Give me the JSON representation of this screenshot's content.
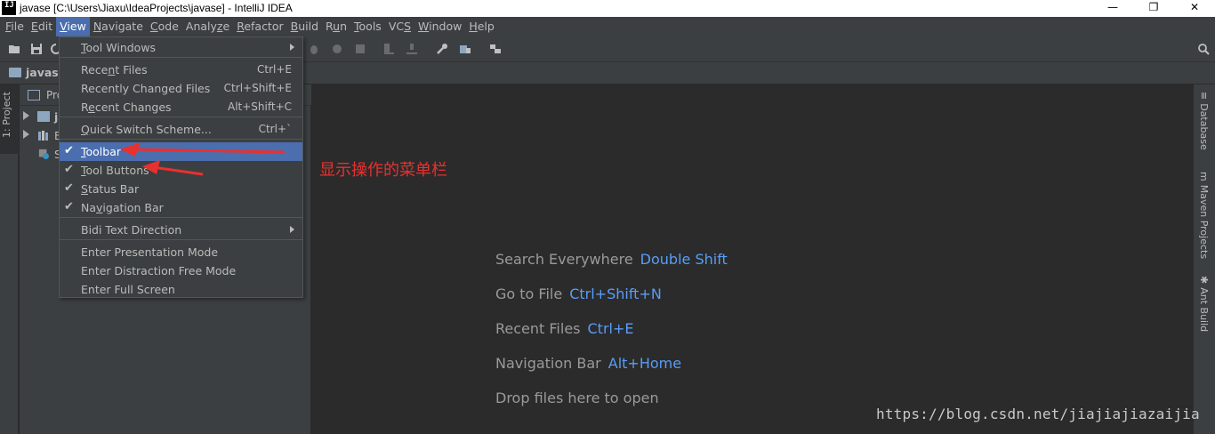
{
  "window": {
    "title": "javase [C:\\Users\\Jiaxu\\IdeaProjects\\javase] - IntelliJ IDEA",
    "app_icon_text": "IJ",
    "minimize_glyph": "—",
    "restore_glyph": "❐",
    "close_glyph": "✕"
  },
  "menubar": {
    "items": [
      {
        "mn": "F",
        "rest": "ile"
      },
      {
        "mn": "E",
        "rest": "dit"
      },
      {
        "mn": "V",
        "rest": "iew"
      },
      {
        "mn": "N",
        "rest": "avigate"
      },
      {
        "mn": "C",
        "rest": "ode"
      },
      {
        "pre": "Analy",
        "mn": "z",
        "rest": "e"
      },
      {
        "mn": "R",
        "rest": "efactor"
      },
      {
        "mn": "B",
        "rest": "uild"
      },
      {
        "pre": "R",
        "mn": "u",
        "rest": "n"
      },
      {
        "mn": "T",
        "rest": "ools"
      },
      {
        "pre": "VC",
        "mn": "S",
        "rest": ""
      },
      {
        "mn": "W",
        "rest": "indow"
      },
      {
        "mn": "H",
        "rest": "elp"
      }
    ],
    "active_index": 2
  },
  "navbar": {
    "label": "javase"
  },
  "left_stripe": {
    "tab_label": "1: Project"
  },
  "project_panel": {
    "header_label": "Pro",
    "rows": [
      "ja",
      "E",
      "S"
    ]
  },
  "view_menu": {
    "items": [
      {
        "pre": "",
        "mn": "T",
        "rest": "ool Windows",
        "shortcut": "",
        "checked": false,
        "submenu": true
      },
      {
        "pre": "Rece",
        "mn": "n",
        "rest": "t Files",
        "shortcut": "Ctrl+E",
        "checked": false,
        "submenu": false
      },
      {
        "pre": "Recently Changed Files",
        "mn": "",
        "rest": "",
        "shortcut": "Ctrl+Shift+E",
        "checked": false,
        "submenu": false
      },
      {
        "pre": "R",
        "mn": "e",
        "rest": "cent Changes",
        "shortcut": "Alt+Shift+C",
        "checked": false,
        "submenu": false
      },
      {
        "pre": "",
        "mn": "Q",
        "rest": "uick Switch Scheme...",
        "shortcut": "Ctrl+`",
        "checked": false,
        "submenu": false
      },
      {
        "pre": "",
        "mn": "T",
        "rest": "oolbar",
        "shortcut": "",
        "checked": true,
        "submenu": false
      },
      {
        "pre": "",
        "mn": "T",
        "rest": "ool Buttons",
        "shortcut": "",
        "checked": true,
        "submenu": false
      },
      {
        "pre": "",
        "mn": "S",
        "rest": "tatus Bar",
        "shortcut": "",
        "checked": true,
        "submenu": false
      },
      {
        "pre": "Na",
        "mn": "v",
        "rest": "igation Bar",
        "shortcut": "",
        "checked": true,
        "submenu": false
      },
      {
        "pre": "Bidi Text Direction",
        "mn": "",
        "rest": "",
        "shortcut": "",
        "checked": false,
        "submenu": true
      },
      {
        "pre": "Enter Presentation Mode",
        "mn": "",
        "rest": "",
        "shortcut": "",
        "checked": false,
        "submenu": false
      },
      {
        "pre": "Enter Distraction Free Mode",
        "mn": "",
        "rest": "",
        "shortcut": "",
        "checked": false,
        "submenu": false
      },
      {
        "pre": "Enter Full Screen",
        "mn": "",
        "rest": "",
        "shortcut": "",
        "checked": false,
        "submenu": false
      }
    ],
    "selected_index": 5,
    "check_glyph": "✔"
  },
  "editor": {
    "hints": [
      {
        "text": "Search Everywhere",
        "key": "Double Shift"
      },
      {
        "text": "Go to File",
        "key": "Ctrl+Shift+N"
      },
      {
        "text": "Recent Files",
        "key": "Ctrl+E"
      },
      {
        "text": "Navigation Bar",
        "key": "Alt+Home"
      },
      {
        "text": "Drop files here to open",
        "key": ""
      }
    ],
    "annotation": "显示操作的菜单栏"
  },
  "right_stripe": {
    "tabs": [
      {
        "prefix": "≡",
        "label": "Database"
      },
      {
        "prefix": "m",
        "label": "Maven Projects"
      },
      {
        "prefix": "✱",
        "label": "Ant Build"
      }
    ]
  },
  "watermark": "https://blog.csdn.net/jiajiajiazaijia",
  "colors": {
    "menu_bg": "#3c3f41",
    "editor_bg": "#2b2b2b",
    "selection": "#4b6eaf",
    "link_blue": "#589df6",
    "annotation_red": "#e8312f"
  }
}
